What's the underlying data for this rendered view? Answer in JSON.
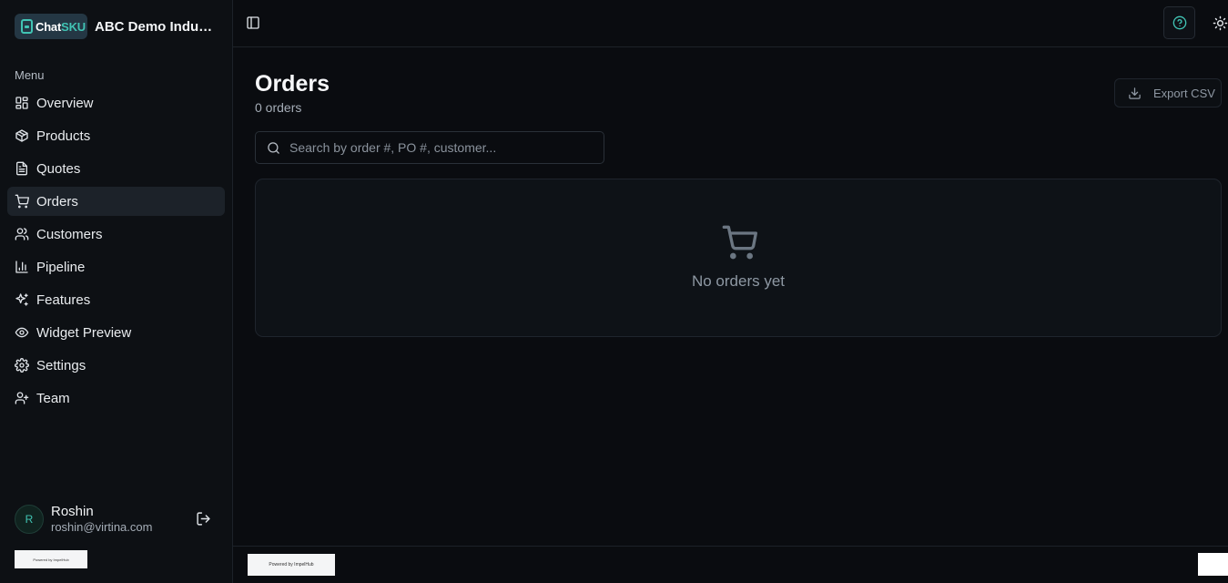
{
  "brand": {
    "logo_part1": "Chat",
    "logo_part2": "SKU",
    "org_name": "ABC Demo Industries"
  },
  "sidebar": {
    "menu_label": "Menu",
    "items": [
      {
        "label": "Overview",
        "icon": "grid-icon"
      },
      {
        "label": "Products",
        "icon": "package-icon"
      },
      {
        "label": "Quotes",
        "icon": "file-text-icon"
      },
      {
        "label": "Orders",
        "icon": "cart-icon",
        "active": true
      },
      {
        "label": "Customers",
        "icon": "users-icon"
      },
      {
        "label": "Pipeline",
        "icon": "bar-chart-icon"
      },
      {
        "label": "Features",
        "icon": "sparkles-icon"
      },
      {
        "label": "Widget Preview",
        "icon": "eye-icon"
      },
      {
        "label": "Settings",
        "icon": "gear-icon"
      },
      {
        "label": "Team",
        "icon": "user-plus-icon"
      }
    ],
    "user": {
      "initial": "R",
      "name": "Roshin",
      "email": "roshin@virtina.com"
    },
    "powered_by": "Powered by ImpelHub"
  },
  "header": {
    "help_icon": "help-circle-icon",
    "theme_icon": "sun-icon"
  },
  "main": {
    "title": "Orders",
    "count": "0 orders",
    "export_label": "Export CSV",
    "search_placeholder": "Search by order #, PO #, customer...",
    "empty_message": "No orders yet",
    "powered_by": "Powered by ImpelHub"
  },
  "colors": {
    "accent": "#41c4b4",
    "background": "#0a0c10",
    "sidebar": "#0d1014",
    "active_item": "#1c2229"
  }
}
